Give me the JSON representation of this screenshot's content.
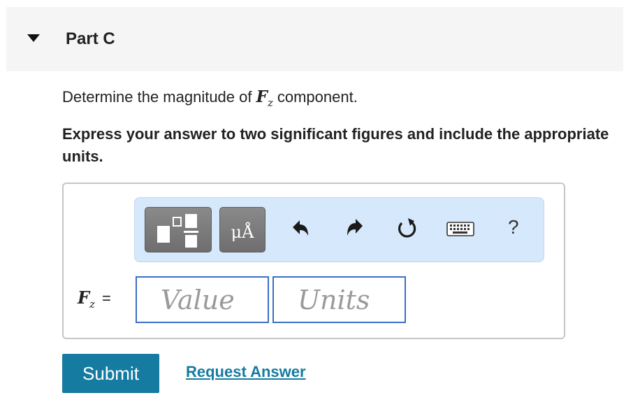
{
  "part": {
    "title": "Part C",
    "caret_icon": "caret-down-icon"
  },
  "question": {
    "prefix": "Determine the magnitude of ",
    "var": "F",
    "sub": "z",
    "suffix": "component."
  },
  "instruction": "Express your answer to two significant figures and include the appropriate units.",
  "toolbar": {
    "template_icon": "templates-icon",
    "units_label": "μÅ",
    "undo_icon": "undo-icon",
    "redo_icon": "redo-icon",
    "reset_icon": "reset-icon",
    "keyboard_icon": "keyboard-icon",
    "help_label": "?",
    "colors": {
      "toolbar_bg": "#d6e8fb",
      "button_bg": "#7b7b7b"
    }
  },
  "answer": {
    "var": "F",
    "sub": "z",
    "equals": "=",
    "value_placeholder": "Value",
    "units_placeholder": "Units",
    "input_border": "#3b6fc5"
  },
  "actions": {
    "submit_label": "Submit",
    "request_label": "Request Answer",
    "accent": "#167ba1"
  }
}
